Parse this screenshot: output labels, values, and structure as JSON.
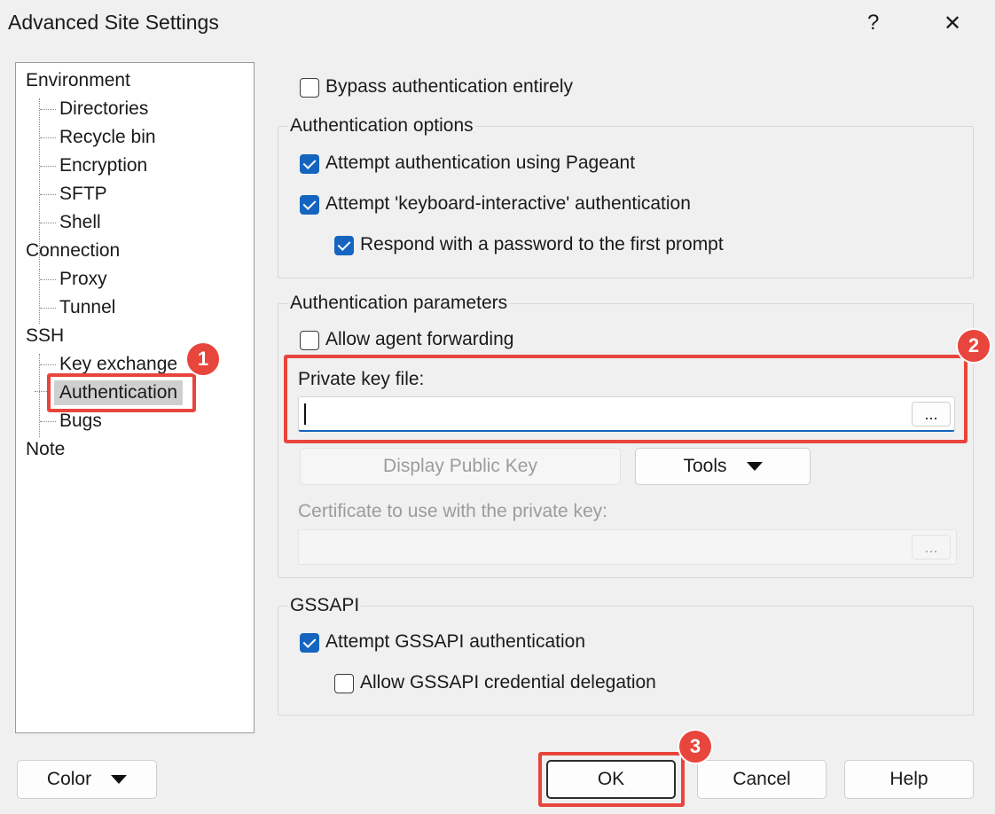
{
  "window": {
    "title": "Advanced Site Settings",
    "help_glyph": "?",
    "close_glyph": "✕"
  },
  "tree": {
    "environment": "Environment",
    "directories": "Directories",
    "recycle_bin": "Recycle bin",
    "encryption": "Encryption",
    "sftp": "SFTP",
    "shell": "Shell",
    "connection": "Connection",
    "proxy": "Proxy",
    "tunnel": "Tunnel",
    "ssh": "SSH",
    "key_exchange": "Key exchange",
    "authentication": "Authentication",
    "bugs": "Bugs",
    "note": "Note"
  },
  "bypass": {
    "label": "Bypass authentication entirely",
    "checked": false
  },
  "auth_options": {
    "title": "Authentication options",
    "pageant": {
      "label": "Attempt authentication using Pageant",
      "checked": true
    },
    "keyboard": {
      "label": "Attempt 'keyboard-interactive' authentication",
      "checked": true
    },
    "respond": {
      "label": "Respond with a password to the first prompt",
      "checked": true
    }
  },
  "auth_params": {
    "title": "Authentication parameters",
    "agent_forwarding": {
      "label": "Allow agent forwarding",
      "checked": false
    },
    "private_key_label": "Private key file:",
    "private_key_value": "",
    "browse_label": "...",
    "display_public_key": "Display Public Key",
    "tools": "Tools",
    "certificate_label": "Certificate to use with the private key:",
    "certificate_value": "",
    "cert_browse_label": "..."
  },
  "gssapi": {
    "title": "GSSAPI",
    "attempt": {
      "label": "Attempt GSSAPI authentication",
      "checked": true
    },
    "delegation": {
      "label": "Allow GSSAPI credential delegation",
      "checked": false
    }
  },
  "footer": {
    "color": "Color",
    "ok": "OK",
    "cancel": "Cancel",
    "help": "Help"
  },
  "callouts": [
    "1",
    "2",
    "3"
  ],
  "colors": {
    "accent": "#1565c0",
    "callout": "#e8453c"
  }
}
